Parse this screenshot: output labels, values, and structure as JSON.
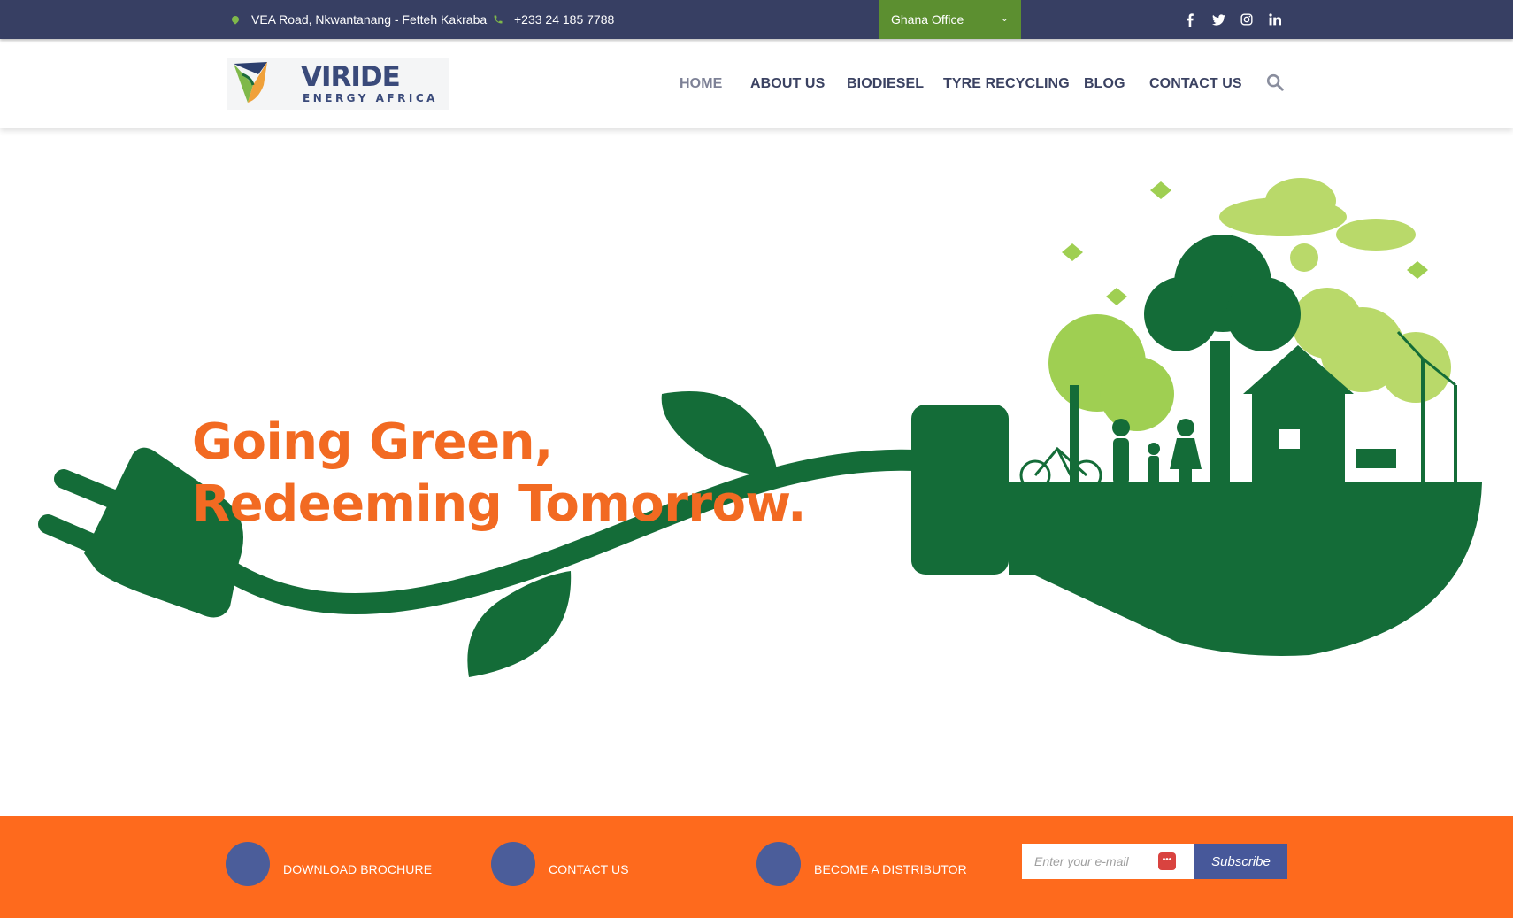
{
  "topbar": {
    "address": "VEA Road, Nkwantanang - Fetteh Kakraba",
    "phone": "+233 24 185 7788",
    "office": "Ghana Office",
    "social": [
      "facebook-icon",
      "twitter-icon",
      "instagram-icon",
      "linkedin-icon"
    ]
  },
  "header": {
    "logo_text": "VIRIDE",
    "logo_sub": "ENERGY AFRICA",
    "nav": [
      "HOME",
      "ABOUT US",
      "BIODIESEL",
      "TYRE RECYCLING",
      "BLOG",
      "CONTACT US"
    ]
  },
  "hero": {
    "line1": "Going Green,",
    "line2": "Redeeming Tomorrow."
  },
  "cta_bar": {
    "items": [
      "DOWNLOAD BROCHURE",
      "CONTACT US",
      "BECOME A DISTRIBUTOR"
    ],
    "email_placeholder": "Enter your e-mail",
    "subscribe_label": "Subscribe",
    "password_icon_text": "•••"
  },
  "colors": {
    "topbar": "#373f63",
    "office_select": "#5c8f30",
    "nav_text": "#3b4262",
    "headline": "#f26a22",
    "cta_bar": "#fe6a1d",
    "cta_circle": "#4b5d9a",
    "subscribe": "#47589a",
    "dark_green": "#146c38",
    "light_green": "#9fcf52"
  }
}
